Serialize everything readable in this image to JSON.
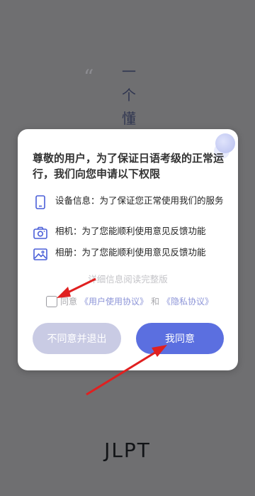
{
  "background": {
    "quote_open": "“",
    "vertical_chars": [
      "一",
      "个",
      "懂"
    ],
    "quote_close": "”",
    "logo": "JLPT"
  },
  "dialog": {
    "title": "尊敬的用户，为了保证日语考级的正常运行，我们向您申请以下权限",
    "permissions": [
      {
        "icon": "phone-icon",
        "text": "设备信息：为了保证您正常使用我们的服务"
      },
      {
        "icon": "camera-icon",
        "text": "相机：为了您能顺利使用意见反馈功能"
      },
      {
        "icon": "image-icon",
        "text": "相册：为了您能顺利使用意见反馈功能"
      }
    ],
    "detail_link": "详细信息阅读完整版",
    "agree_prefix": "同意",
    "user_agreement": "《用户使用协议》",
    "and": "和",
    "privacy_agreement": "《隐私协议》",
    "decline_button": "不同意并退出",
    "accept_button": "我同意"
  },
  "colors": {
    "accent": "#5b6fe0",
    "decline": "#c9cbe4",
    "annotation_arrow": "#e02020"
  }
}
